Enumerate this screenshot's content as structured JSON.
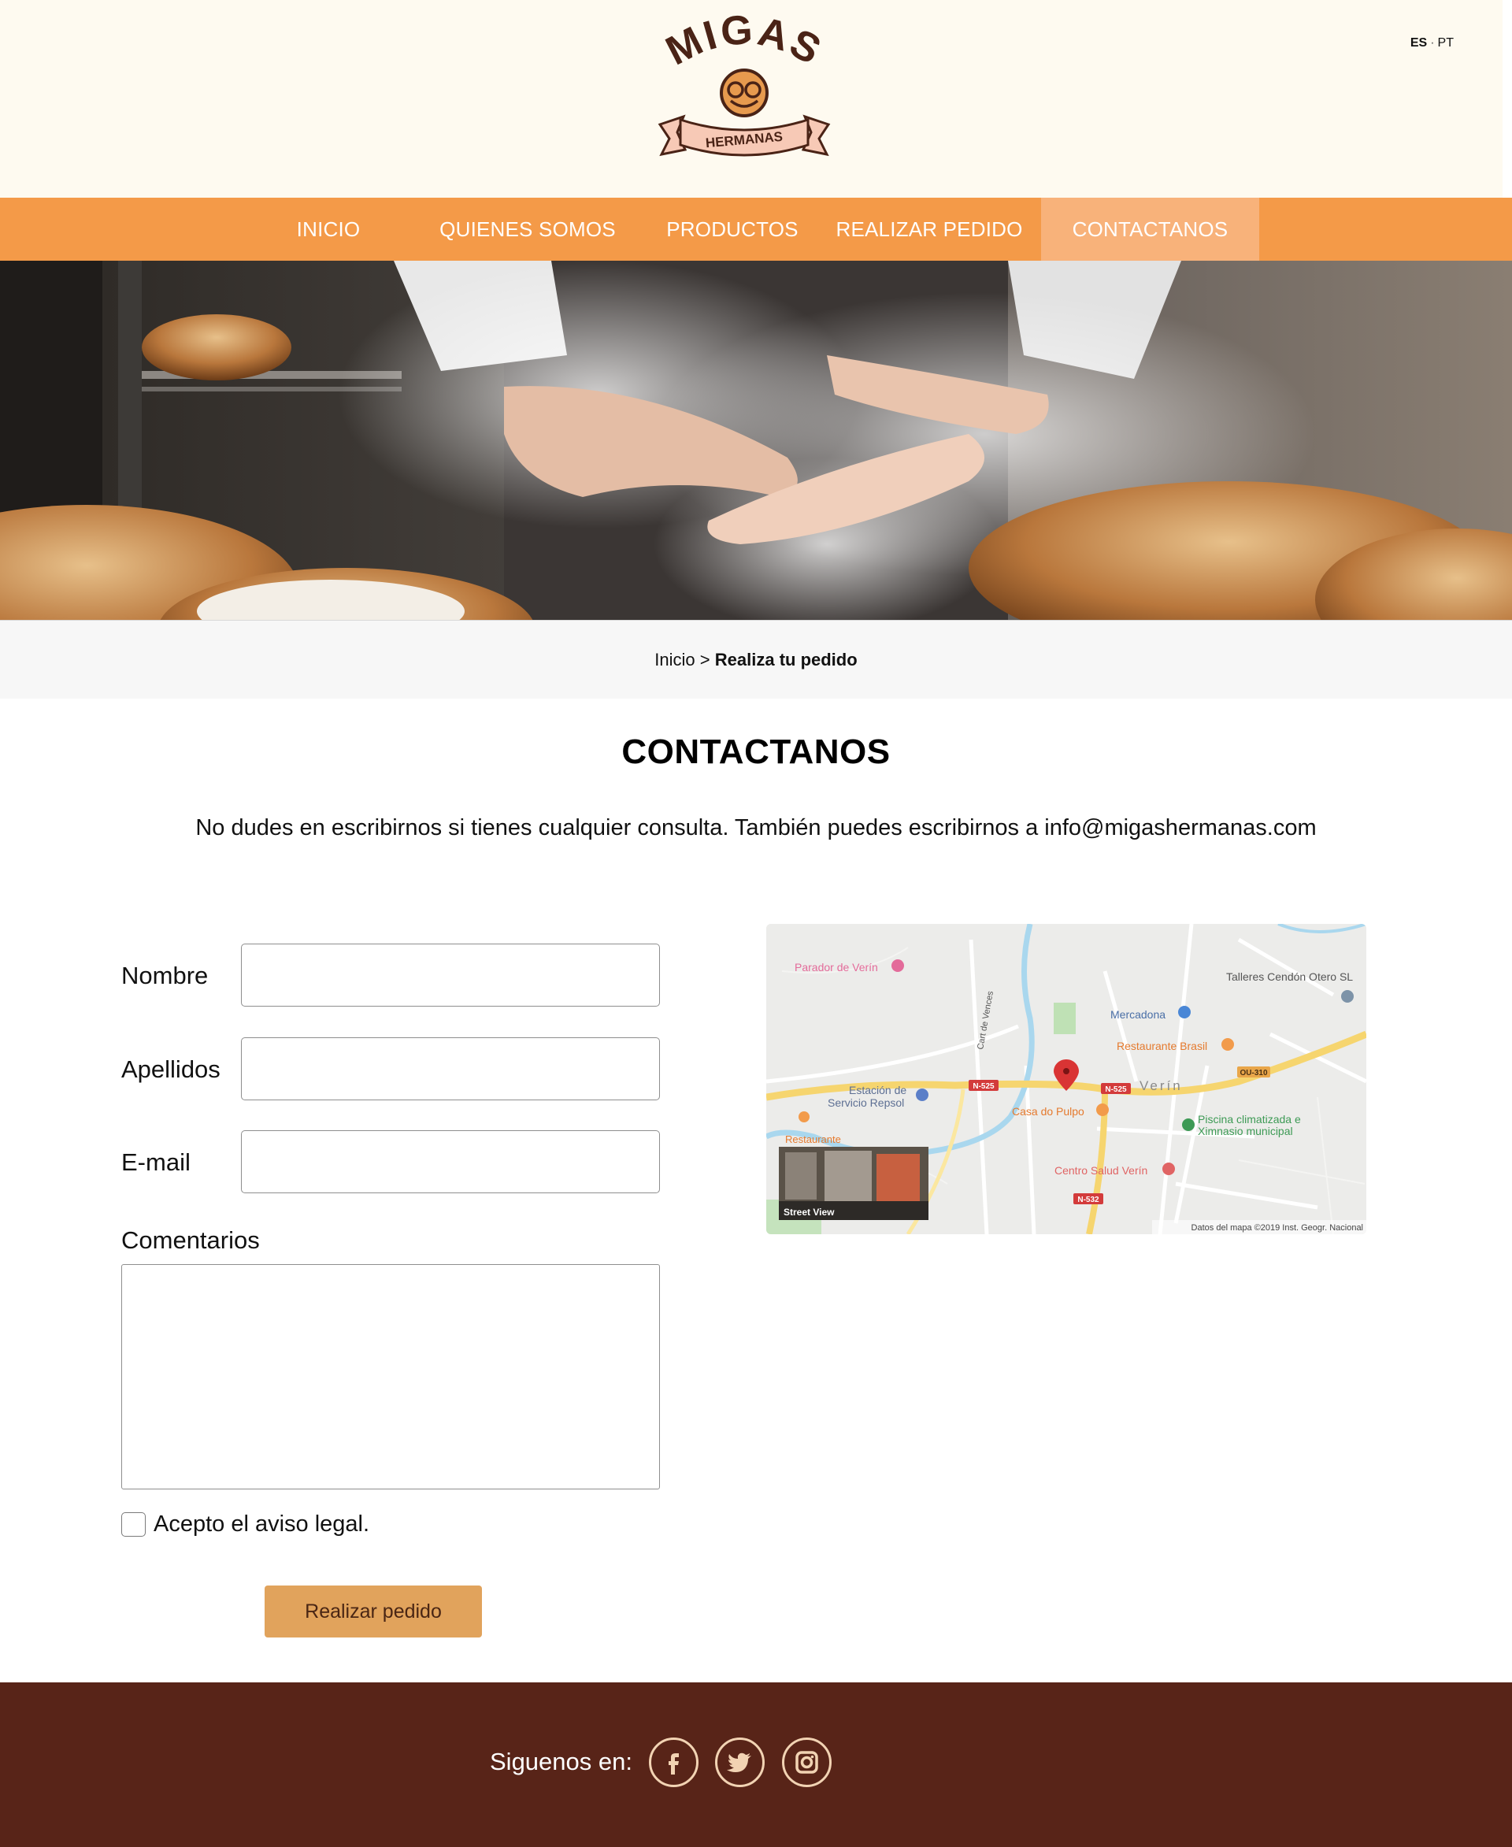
{
  "header": {
    "logo_text": "MIGAS",
    "logo_banner_text": "HERMANAS",
    "lang_es": "ES",
    "lang_sep": "·",
    "lang_pt": "PT"
  },
  "nav": {
    "items": [
      {
        "label": "INICIO"
      },
      {
        "label": "QUIENES SOMOS"
      },
      {
        "label": "PRODUCTOS"
      },
      {
        "label": "REALIZAR PEDIDO"
      },
      {
        "label": "CONTACTANOS"
      }
    ],
    "active": "CONTACTANOS"
  },
  "breadcrumb": {
    "home": "Inicio",
    "separator": ">",
    "current": "Realiza tu pedido"
  },
  "main": {
    "title": "CONTACTANOS",
    "intro": "No dudes en escribirnos si tienes cualquier consulta. También puedes escribirnos a  info@migashermanas.com"
  },
  "form": {
    "nombre_label": "Nombre",
    "nombre_value": "",
    "apellidos_label": "Apellidos",
    "apellidos_value": "",
    "email_label": "E-mail",
    "email_value": "",
    "comentarios_label": "Comentarios",
    "comentarios_value": "",
    "legal_label": "Acepto el aviso legal.",
    "legal_checked": false,
    "submit_label": "Realizar pedido"
  },
  "map": {
    "labels": {
      "parador": "Parador de Verín",
      "talleres": "Talleres Cendón Otero SL",
      "mercadona": "Mercadona",
      "restaurante_brasil": "Restaurante Brasil",
      "estacion_1": "Estación de",
      "estacion_2": "Servicio Repsol",
      "casa_pulpo": "Casa do Pulpo",
      "verin": "Verín",
      "piscina_1": "Piscina climatizada e",
      "piscina_2": "Ximnasio municipal",
      "restaurante": "Restaurante",
      "centro_salud": "Centro Salud Verín",
      "cart_vences": "Cart de Vences",
      "n525_a": "N-525",
      "n525_b": "N-525",
      "ou310": "OU-310",
      "n532": "N-532",
      "street_view": "Street View",
      "attribution": "Datos del mapa ©2019 Inst. Geogr. Nacional"
    }
  },
  "footer": {
    "follow_label": "Siguenos en:",
    "social": [
      {
        "name": "facebook-icon"
      },
      {
        "name": "twitter-icon"
      },
      {
        "name": "instagram-icon"
      }
    ]
  },
  "colors": {
    "nav_bg": "#f49a48",
    "nav_active": "#f8b27a",
    "header_bg": "#fefaf0",
    "footer_bg": "#582418",
    "button_bg": "#e1a35c",
    "logo_brown": "#4a2316",
    "logo_orange": "#e79a4e",
    "logo_pink": "#f7c9b6"
  }
}
